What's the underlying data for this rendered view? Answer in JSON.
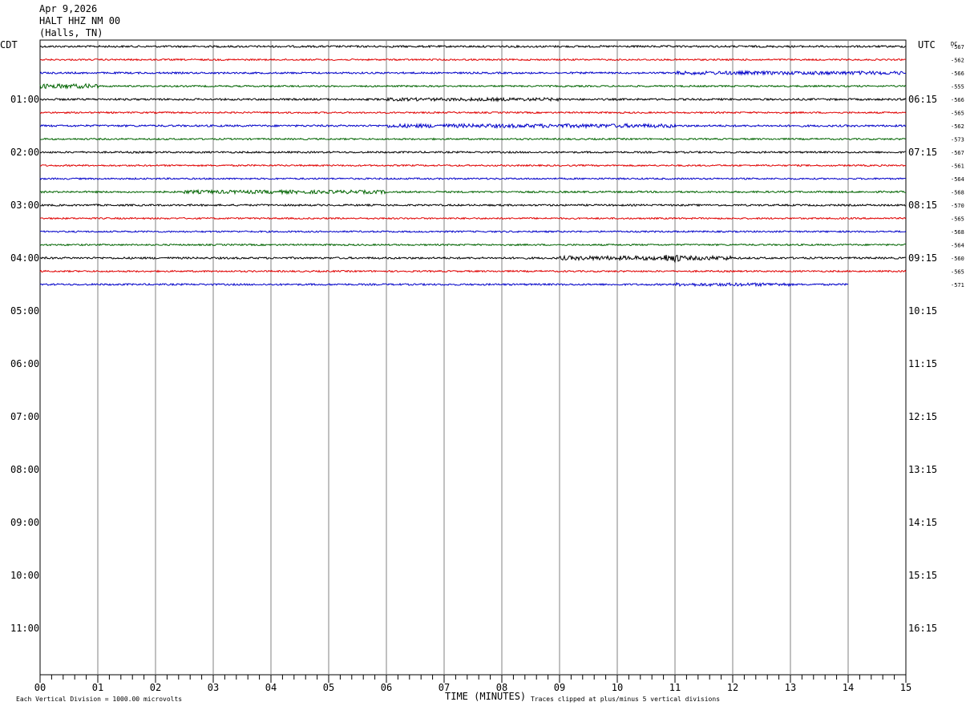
{
  "header": {
    "date": "Apr 9,2026",
    "station": "HALT HHZ NM 00",
    "location": "(Halls, TN)"
  },
  "chart_data": {
    "type": "line",
    "left_axis_title": "CDT",
    "right_axis_title": "UTC",
    "dc_title": "DC",
    "x_axis_label": "TIME (MINUTES)",
    "x_ticks": [
      "00",
      "01",
      "02",
      "03",
      "04",
      "05",
      "06",
      "07",
      "08",
      "09",
      "10",
      "11",
      "12",
      "13",
      "14",
      "15"
    ],
    "x_range": [
      0,
      15
    ],
    "left_hour_labels": [
      "01:00",
      "02:00",
      "03:00",
      "04:00",
      "05:00",
      "06:00",
      "07:00",
      "08:00",
      "09:00",
      "10:00",
      "11:00"
    ],
    "right_hour_labels": [
      "06:15",
      "07:15",
      "08:15",
      "09:15",
      "10:15",
      "11:15",
      "12:15",
      "13:15",
      "14:15",
      "15:15",
      "16:15"
    ],
    "footer_left": "Each Vertical Division = 1000.00 microvolts",
    "footer_right": "Traces clipped at plus/minus 5 vertical divisions",
    "trace_colors": [
      "#000000",
      "#e00000",
      "#0000c8",
      "#006400"
    ],
    "traces": [
      {
        "dc": "567",
        "end_minute": 15,
        "amplitude": 1.2,
        "bursts": []
      },
      {
        "dc": "562",
        "end_minute": 15,
        "amplitude": 1.0,
        "bursts": []
      },
      {
        "dc": "566",
        "end_minute": 15,
        "amplitude": 1.1,
        "bursts": [
          [
            11,
            15,
            2.2
          ]
        ]
      },
      {
        "dc": "555",
        "end_minute": 15,
        "amplitude": 1.0,
        "bursts": [
          [
            0,
            1,
            2.8
          ]
        ]
      },
      {
        "dc": "566",
        "end_minute": 15,
        "amplitude": 1.2,
        "bursts": [
          [
            6,
            9,
            2.0
          ]
        ]
      },
      {
        "dc": "565",
        "end_minute": 15,
        "amplitude": 1.0,
        "bursts": []
      },
      {
        "dc": "562",
        "end_minute": 15,
        "amplitude": 1.2,
        "bursts": [
          [
            6,
            11,
            2.4
          ]
        ]
      },
      {
        "dc": "573",
        "end_minute": 15,
        "amplitude": 1.0,
        "bursts": []
      },
      {
        "dc": "567",
        "end_minute": 15,
        "amplitude": 1.1,
        "bursts": []
      },
      {
        "dc": "561",
        "end_minute": 15,
        "amplitude": 1.0,
        "bursts": []
      },
      {
        "dc": "564",
        "end_minute": 15,
        "amplitude": 1.0,
        "bursts": []
      },
      {
        "dc": "568",
        "end_minute": 15,
        "amplitude": 1.1,
        "bursts": [
          [
            2.5,
            6,
            2.2
          ]
        ]
      },
      {
        "dc": "570",
        "end_minute": 15,
        "amplitude": 1.1,
        "bursts": []
      },
      {
        "dc": "565",
        "end_minute": 15,
        "amplitude": 1.0,
        "bursts": []
      },
      {
        "dc": "568",
        "end_minute": 15,
        "amplitude": 1.0,
        "bursts": []
      },
      {
        "dc": "564",
        "end_minute": 15,
        "amplitude": 1.0,
        "bursts": []
      },
      {
        "dc": "560",
        "end_minute": 15,
        "amplitude": 1.2,
        "bursts": [
          [
            9,
            12,
            2.6
          ],
          [
            10.8,
            11.1,
            5.0
          ]
        ]
      },
      {
        "dc": "565",
        "end_minute": 15,
        "amplitude": 1.0,
        "bursts": []
      },
      {
        "dc": "571",
        "end_minute": 14,
        "amplitude": 1.1,
        "bursts": [
          [
            11,
            13,
            2.0
          ]
        ]
      }
    ]
  }
}
